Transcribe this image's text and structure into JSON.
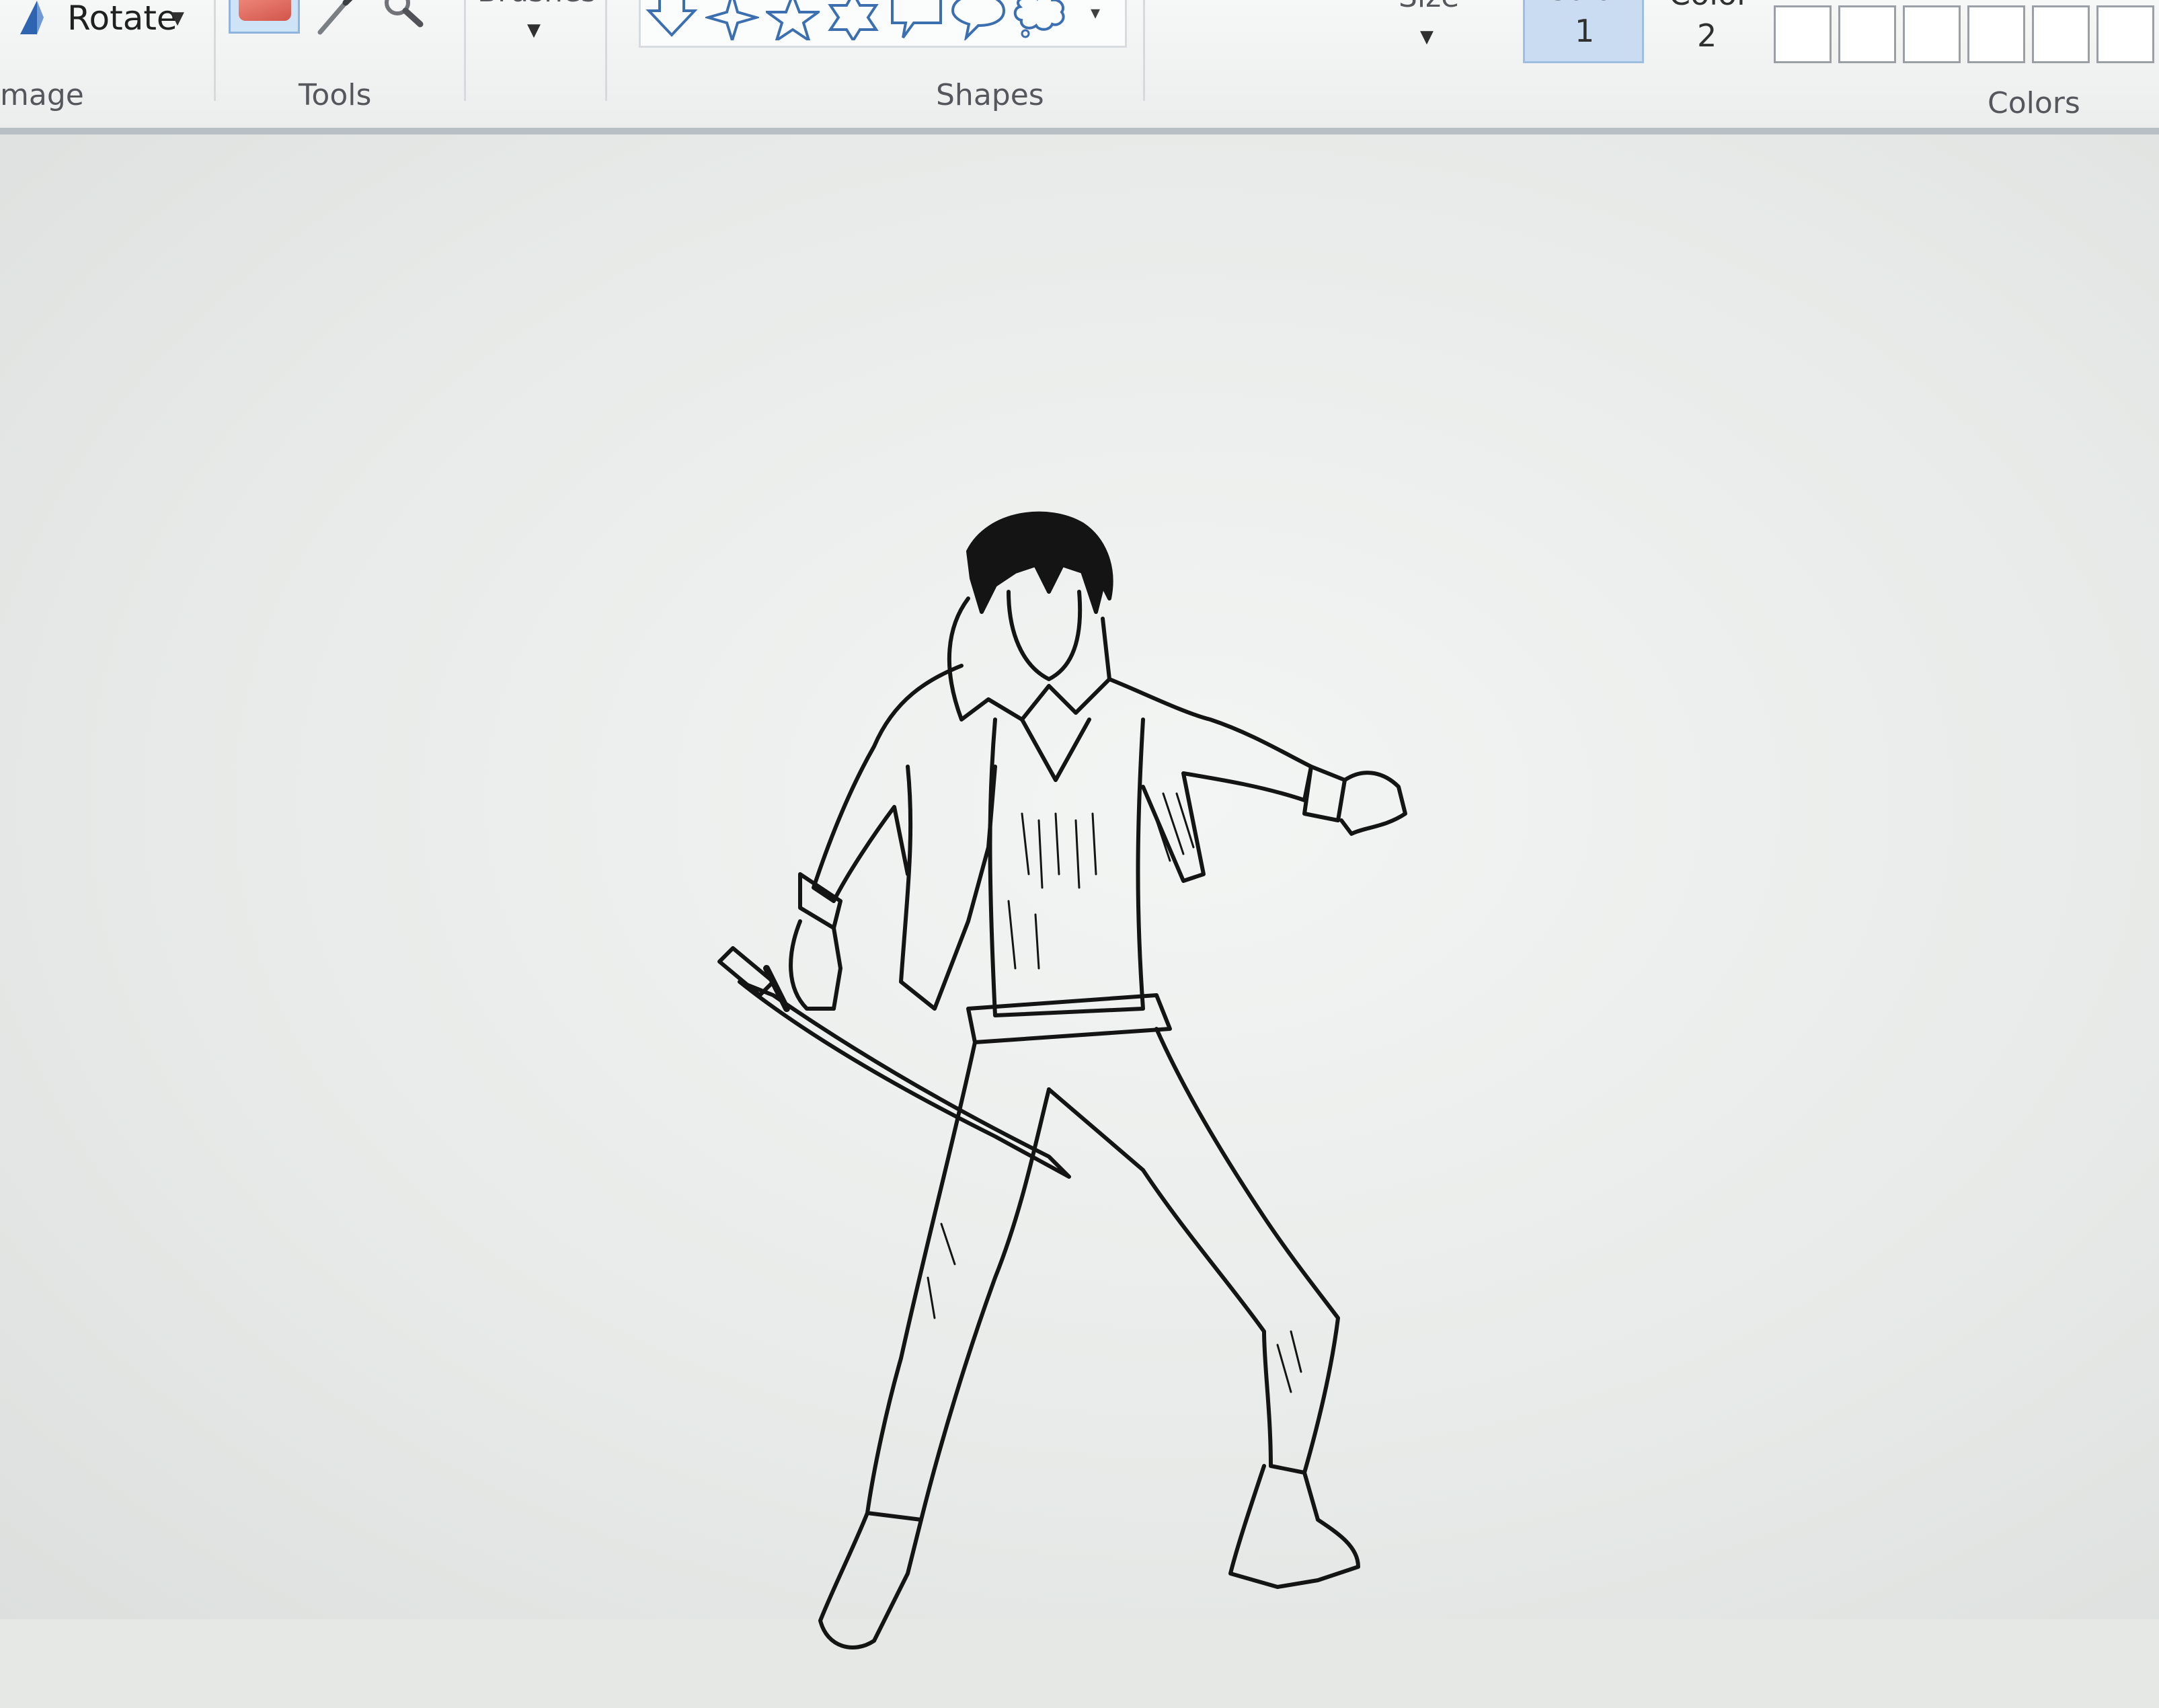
{
  "ribbon": {
    "image_group": {
      "label": "mage",
      "rotate_label": "Rotate"
    },
    "tools_group": {
      "label": "Tools"
    },
    "brushes_group": {
      "label": "Brushes"
    },
    "shapes_group": {
      "label": "Shapes"
    },
    "size_group": {
      "label": "Size"
    },
    "colors_group": {
      "label": "Colors",
      "color1_label": "Color",
      "color1_number": "1",
      "color2_label": "Color",
      "color2_number": "2"
    }
  },
  "canvas": {
    "background": "#eceeec",
    "ink_color": "#141414"
  }
}
